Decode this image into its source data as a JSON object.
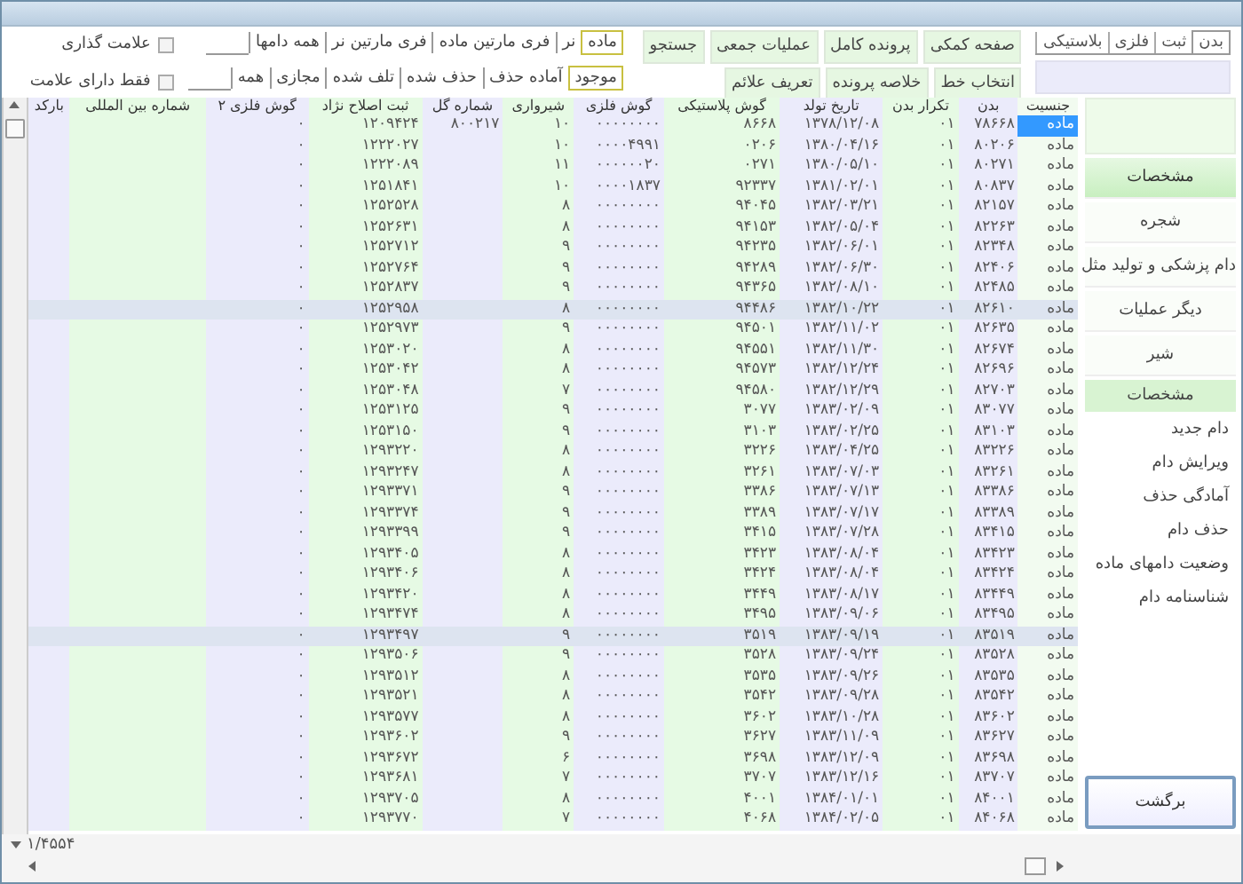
{
  "view_tabs": [
    {
      "label": "بدن",
      "selected": true
    },
    {
      "label": "ثبت",
      "selected": false
    },
    {
      "label": "فلزی",
      "selected": false
    },
    {
      "label": "بلاستیکی",
      "selected": false
    }
  ],
  "action_rows": [
    [
      "صفحه کمکی",
      "پرونده کامل",
      "عملیات جمعی",
      "جستجو"
    ],
    [
      "انتخاب خط",
      "خلاصه پرونده",
      "تعریف علائم"
    ]
  ],
  "sex_filter": [
    {
      "label": "ماده",
      "selected": true
    },
    {
      "label": "نر",
      "selected": false
    },
    {
      "label": "فری مارتین ماده",
      "selected": false
    },
    {
      "label": "فری مارتین نر",
      "selected": false
    },
    {
      "label": "همه دامها",
      "selected": false
    }
  ],
  "status_filter": [
    {
      "label": "موجود",
      "selected": true
    },
    {
      "label": "آماده حذف",
      "selected": false
    },
    {
      "label": "حذف شده",
      "selected": false
    },
    {
      "label": "تلف شده",
      "selected": false
    },
    {
      "label": "مجازی",
      "selected": false
    },
    {
      "label": "همه",
      "selected": false
    }
  ],
  "checkboxes": [
    {
      "label": "علامت گذاری",
      "checked": false
    },
    {
      "label": "فقط دارای علامت",
      "checked": false
    }
  ],
  "table": {
    "columns": [
      "جنسیت",
      "بدن",
      "تکرار بدن",
      "تاریخ تولد",
      "گوش پلاستیکی",
      "گوش فلزی",
      "شیرواری",
      "شماره گل",
      "ثبت اصلاح نژاد",
      "گوش فلزی ۲",
      "شماره بین المللی",
      "بارکد"
    ],
    "rows": [
      {
        "cells": [
          "ماده",
          "۷۸۶۶۸",
          "۰۱",
          "۱۳۷۸/۱۲/۰۸",
          "۸۶۶۸",
          "۰۰۰۰۰۰۰۰",
          "۱۰",
          "۸۰۰۲۱۷",
          "۱۲۰۹۴۲۴",
          "۰",
          null,
          null
        ],
        "selected": true,
        "highlighted": false
      },
      {
        "cells": [
          "ماده",
          "۸۰۲۰۶",
          "۰۱",
          "۱۳۸۰/۰۴/۱۶",
          "۰۲۰۶",
          "۰۰۰۰۴۹۹۱",
          "۱۰",
          null,
          "۱۲۲۲۰۲۷",
          "۰",
          null,
          null
        ],
        "selected": false,
        "highlighted": false
      },
      {
        "cells": [
          "ماده",
          "۸۰۲۷۱",
          "۰۱",
          "۱۳۸۰/۰۵/۱۰",
          "۰۲۷۱",
          "۰۰۰۰۰۰۲۰",
          "۱۱",
          null,
          "۱۲۲۲۰۸۹",
          "۰",
          null,
          null
        ],
        "selected": false,
        "highlighted": false
      },
      {
        "cells": [
          "ماده",
          "۸۰۸۳۷",
          "۰۱",
          "۱۳۸۱/۰۲/۰۱",
          "۹۲۳۳۷",
          "۰۰۰۰۱۸۳۷",
          "۱۰",
          null,
          "۱۲۵۱۸۴۱",
          "۰",
          null,
          null
        ],
        "selected": false,
        "highlighted": false
      },
      {
        "cells": [
          "ماده",
          "۸۲۱۵۷",
          "۰۱",
          "۱۳۸۲/۰۳/۲۱",
          "۹۴۰۴۵",
          "۰۰۰۰۰۰۰۰",
          "۸",
          null,
          "۱۲۵۲۵۲۸",
          "۰",
          null,
          null
        ],
        "selected": false,
        "highlighted": false
      },
      {
        "cells": [
          "ماده",
          "۸۲۲۶۳",
          "۰۱",
          "۱۳۸۲/۰۵/۰۴",
          "۹۴۱۵۳",
          "۰۰۰۰۰۰۰۰",
          "۸",
          null,
          "۱۲۵۲۶۳۱",
          "۰",
          null,
          null
        ],
        "selected": false,
        "highlighted": false
      },
      {
        "cells": [
          "ماده",
          "۸۲۳۴۸",
          "۰۱",
          "۱۳۸۲/۰۶/۰۱",
          "۹۴۲۳۵",
          "۰۰۰۰۰۰۰۰",
          "۹",
          null,
          "۱۲۵۲۷۱۲",
          "۰",
          null,
          null
        ],
        "selected": false,
        "highlighted": false
      },
      {
        "cells": [
          "ماده",
          "۸۲۴۰۶",
          "۰۱",
          "۱۳۸۲/۰۶/۳۰",
          "۹۴۲۸۹",
          "۰۰۰۰۰۰۰۰",
          "۹",
          null,
          "۱۲۵۲۷۶۴",
          "۰",
          null,
          null
        ],
        "selected": false,
        "highlighted": false
      },
      {
        "cells": [
          "ماده",
          "۸۲۴۸۵",
          "۰۱",
          "۱۳۸۲/۰۸/۱۰",
          "۹۴۳۶۵",
          "۰۰۰۰۰۰۰۰",
          "۹",
          null,
          "۱۲۵۲۸۳۷",
          "۰",
          null,
          null
        ],
        "selected": false,
        "highlighted": false
      },
      {
        "cells": [
          "ماده",
          "۸۲۶۱۰",
          "۰۱",
          "۱۳۸۲/۱۰/۲۲",
          "۹۴۴۸۶",
          "۰۰۰۰۰۰۰۰",
          "۸",
          null,
          "۱۲۵۲۹۵۸",
          "۰",
          null,
          null
        ],
        "selected": false,
        "highlighted": true
      },
      {
        "cells": [
          "ماده",
          "۸۲۶۳۵",
          "۰۱",
          "۱۳۸۲/۱۱/۰۲",
          "۹۴۵۰۱",
          "۰۰۰۰۰۰۰۰",
          "۹",
          null,
          "۱۲۵۲۹۷۳",
          "۰",
          null,
          null
        ],
        "selected": false,
        "highlighted": false
      },
      {
        "cells": [
          "ماده",
          "۸۲۶۷۴",
          "۰۱",
          "۱۳۸۲/۱۱/۳۰",
          "۹۴۵۵۱",
          "۰۰۰۰۰۰۰۰",
          "۸",
          null,
          "۱۲۵۳۰۲۰",
          "۰",
          null,
          null
        ],
        "selected": false,
        "highlighted": false
      },
      {
        "cells": [
          "ماده",
          "۸۲۶۹۶",
          "۰۱",
          "۱۳۸۲/۱۲/۲۴",
          "۹۴۵۷۳",
          "۰۰۰۰۰۰۰۰",
          "۸",
          null,
          "۱۲۵۳۰۴۲",
          "۰",
          null,
          null
        ],
        "selected": false,
        "highlighted": false
      },
      {
        "cells": [
          "ماده",
          "۸۲۷۰۳",
          "۰۱",
          "۱۳۸۲/۱۲/۲۹",
          "۹۴۵۸۰",
          "۰۰۰۰۰۰۰۰",
          "۷",
          null,
          "۱۲۵۳۰۴۸",
          "۰",
          null,
          null
        ],
        "selected": false,
        "highlighted": false
      },
      {
        "cells": [
          "ماده",
          "۸۳۰۷۷",
          "۰۱",
          "۱۳۸۳/۰۲/۰۹",
          "۳۰۷۷",
          "۰۰۰۰۰۰۰۰",
          "۹",
          null,
          "۱۲۵۳۱۲۵",
          "۰",
          null,
          null
        ],
        "selected": false,
        "highlighted": false
      },
      {
        "cells": [
          "ماده",
          "۸۳۱۰۳",
          "۰۱",
          "۱۳۸۳/۰۲/۲۵",
          "۳۱۰۳",
          "۰۰۰۰۰۰۰۰",
          "۹",
          null,
          "۱۲۵۳۱۵۰",
          "۰",
          null,
          null
        ],
        "selected": false,
        "highlighted": false
      },
      {
        "cells": [
          "ماده",
          "۸۳۲۲۶",
          "۰۱",
          "۱۳۸۳/۰۴/۲۵",
          "۳۲۲۶",
          "۰۰۰۰۰۰۰۰",
          "۸",
          null,
          "۱۲۹۳۲۲۰",
          "۰",
          null,
          null
        ],
        "selected": false,
        "highlighted": false
      },
      {
        "cells": [
          "ماده",
          "۸۳۲۶۱",
          "۰۱",
          "۱۳۸۳/۰۷/۰۳",
          "۳۲۶۱",
          "۰۰۰۰۰۰۰۰",
          "۸",
          null,
          "۱۲۹۳۲۴۷",
          "۰",
          null,
          null
        ],
        "selected": false,
        "highlighted": false
      },
      {
        "cells": [
          "ماده",
          "۸۳۳۸۶",
          "۰۱",
          "۱۳۸۳/۰۷/۱۳",
          "۳۳۸۶",
          "۰۰۰۰۰۰۰۰",
          "۹",
          null,
          "۱۲۹۳۳۷۱",
          "۰",
          null,
          null
        ],
        "selected": false,
        "highlighted": false
      },
      {
        "cells": [
          "ماده",
          "۸۳۳۸۹",
          "۰۱",
          "۱۳۸۳/۰۷/۱۷",
          "۳۳۸۹",
          "۰۰۰۰۰۰۰۰",
          "۹",
          null,
          "۱۲۹۳۳۷۴",
          "۰",
          null,
          null
        ],
        "selected": false,
        "highlighted": false
      },
      {
        "cells": [
          "ماده",
          "۸۳۴۱۵",
          "۰۱",
          "۱۳۸۳/۰۷/۲۸",
          "۳۴۱۵",
          "۰۰۰۰۰۰۰۰",
          "۹",
          null,
          "۱۲۹۳۳۹۹",
          "۰",
          null,
          null
        ],
        "selected": false,
        "highlighted": false
      },
      {
        "cells": [
          "ماده",
          "۸۳۴۲۳",
          "۰۱",
          "۱۳۸۳/۰۸/۰۴",
          "۳۴۲۳",
          "۰۰۰۰۰۰۰۰",
          "۸",
          null,
          "۱۲۹۳۴۰۵",
          "۰",
          null,
          null
        ],
        "selected": false,
        "highlighted": false
      },
      {
        "cells": [
          "ماده",
          "۸۳۴۲۴",
          "۰۱",
          "۱۳۸۳/۰۸/۰۴",
          "۳۴۲۴",
          "۰۰۰۰۰۰۰۰",
          "۸",
          null,
          "۱۲۹۳۴۰۶",
          "۰",
          null,
          null
        ],
        "selected": false,
        "highlighted": false
      },
      {
        "cells": [
          "ماده",
          "۸۳۴۴۹",
          "۰۱",
          "۱۳۸۳/۰۸/۱۷",
          "۳۴۴۹",
          "۰۰۰۰۰۰۰۰",
          "۸",
          null,
          "۱۲۹۳۴۲۰",
          "۰",
          null,
          null
        ],
        "selected": false,
        "highlighted": false
      },
      {
        "cells": [
          "ماده",
          "۸۳۴۹۵",
          "۰۱",
          "۱۳۸۳/۰۹/۰۶",
          "۳۴۹۵",
          "۰۰۰۰۰۰۰۰",
          "۸",
          null,
          "۱۲۹۳۴۷۴",
          "۰",
          null,
          null
        ],
        "selected": false,
        "highlighted": false
      },
      {
        "cells": [
          "ماده",
          "۸۳۵۱۹",
          "۰۱",
          "۱۳۸۳/۰۹/۱۹",
          "۳۵۱۹",
          "۰۰۰۰۰۰۰۰",
          "۹",
          null,
          "۱۲۹۳۴۹۷",
          "۰",
          null,
          null
        ],
        "selected": false,
        "highlighted": true
      },
      {
        "cells": [
          "ماده",
          "۸۳۵۲۸",
          "۰۱",
          "۱۳۸۳/۰۹/۲۴",
          "۳۵۲۸",
          "۰۰۰۰۰۰۰۰",
          "۹",
          null,
          "۱۲۹۳۵۰۶",
          "۰",
          null,
          null
        ],
        "selected": false,
        "highlighted": false
      },
      {
        "cells": [
          "ماده",
          "۸۳۵۳۵",
          "۰۱",
          "۱۳۸۳/۰۹/۲۶",
          "۳۵۳۵",
          "۰۰۰۰۰۰۰۰",
          "۸",
          null,
          "۱۲۹۳۵۱۲",
          "۰",
          null,
          null
        ],
        "selected": false,
        "highlighted": false
      },
      {
        "cells": [
          "ماده",
          "۸۳۵۴۲",
          "۰۱",
          "۱۳۸۳/۰۹/۲۸",
          "۳۵۴۲",
          "۰۰۰۰۰۰۰۰",
          "۸",
          null,
          "۱۲۹۳۵۲۱",
          "۰",
          null,
          null
        ],
        "selected": false,
        "highlighted": false
      },
      {
        "cells": [
          "ماده",
          "۸۳۶۰۲",
          "۰۱",
          "۱۳۸۳/۱۰/۲۸",
          "۳۶۰۲",
          "۰۰۰۰۰۰۰۰",
          "۸",
          null,
          "۱۲۹۳۵۷۷",
          "۰",
          null,
          null
        ],
        "selected": false,
        "highlighted": false
      },
      {
        "cells": [
          "ماده",
          "۸۳۶۲۷",
          "۰۱",
          "۱۳۸۳/۱۱/۰۹",
          "۳۶۲۷",
          "۰۰۰۰۰۰۰۰",
          "۹",
          null,
          "۱۲۹۳۶۰۲",
          "۰",
          null,
          null
        ],
        "selected": false,
        "highlighted": false
      },
      {
        "cells": [
          "ماده",
          "۸۳۶۹۸",
          "۰۱",
          "۱۳۸۳/۱۲/۰۹",
          "۳۶۹۸",
          "۰۰۰۰۰۰۰۰",
          "۶",
          null,
          "۱۲۹۳۶۷۲",
          "۰",
          null,
          null
        ],
        "selected": false,
        "highlighted": false
      },
      {
        "cells": [
          "ماده",
          "۸۳۷۰۷",
          "۰۱",
          "۱۳۸۳/۱۲/۱۶",
          "۳۷۰۷",
          "۰۰۰۰۰۰۰۰",
          "۷",
          null,
          "۱۲۹۳۶۸۱",
          "۰",
          null,
          null
        ],
        "selected": false,
        "highlighted": false
      },
      {
        "cells": [
          "ماده",
          "۸۴۰۰۱",
          "۰۱",
          "۱۳۸۴/۰۱/۰۱",
          "۴۰۰۱",
          "۰۰۰۰۰۰۰۰",
          "۸",
          null,
          "۱۲۹۳۷۰۵",
          "۰",
          null,
          null
        ],
        "selected": false,
        "highlighted": false
      },
      {
        "cells": [
          "ماده",
          "۸۴۰۶۸",
          "۰۱",
          "۱۳۸۴/۰۲/۰۵",
          "۴۰۶۸",
          "۰۰۰۰۰۰۰۰",
          "۷",
          null,
          "۱۲۹۳۷۷۰",
          "۰",
          null,
          null
        ],
        "selected": false,
        "highlighted": false
      }
    ]
  },
  "sidebar": {
    "menu": [
      {
        "label": "مشخصات",
        "selected": true
      },
      {
        "label": "شجره",
        "selected": false
      },
      {
        "label": "دام پزشکی و تولید مثل",
        "selected": false
      },
      {
        "label": "دیگر عملیات",
        "selected": false
      },
      {
        "label": "شیر",
        "selected": false
      }
    ],
    "section_title": "مشخصات",
    "section_items": [
      "دام جدید",
      "ویرایش دام",
      "آمادگی حذف",
      "حذف دام",
      "وضعیت دامهای ماده",
      "شناسنامه دام"
    ]
  },
  "back_button": "برگشت",
  "record_counter": "۱/۴۵۵۴"
}
